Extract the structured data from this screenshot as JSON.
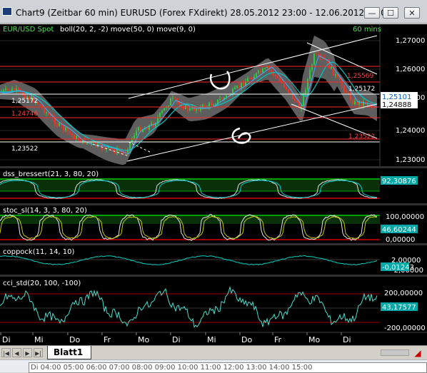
{
  "window": {
    "title": "Chart9 (Zeitbar 60 min)  EURUSD (Forex FXdirekt) 28.05.2012 23:00 - 12.06.2012 20:00",
    "minimize_glyph": "—",
    "maximize_glyph": "☐",
    "close_glyph": "✕"
  },
  "price_panel": {
    "symbol_label": "EUR/USD Spot",
    "indicators_label": "boll(20, 2, -2) move(50, 0) move(9, 0)",
    "timeframe_label": "60 mins",
    "axis_ticks": [
      "1,27000",
      "1,26000",
      "1,25000",
      "1,24000",
      "1,23000"
    ],
    "price_boxes": [
      {
        "text": "1,25101",
        "style": "box-white"
      },
      {
        "text": "1,24888",
        "style": "box-white"
      }
    ],
    "line_labels": {
      "right_red_top": "1,25569",
      "right_white": "1,25172",
      "right_red_bottom": "1,23522",
      "left_white": "1,25172",
      "left_red": "1,24746",
      "left_low": "1,23522"
    }
  },
  "panels": [
    {
      "name": "dss",
      "label": "dss_bressert(21, 3, 80, 20)",
      "value_box": "92,30876",
      "ticks": []
    },
    {
      "name": "stoc",
      "label": "stoc_sl(14, 3, 3, 80, 20)",
      "value_box": "46,60244",
      "ticks": [
        "100,00000",
        "0,00000"
      ]
    },
    {
      "name": "coppock",
      "label": "coppock(11, 14, 10)",
      "value_box": "-0,01243",
      "ticks": [
        "2,00000",
        "-2,00000"
      ]
    },
    {
      "name": "cci",
      "label": "cci_std(20, 100, -100)",
      "value_box": "43,17577",
      "ticks": [
        "200,00000",
        "-200,00000"
      ]
    }
  ],
  "time_axis": [
    "Di",
    "Mi",
    "Do",
    "Fr",
    "Mo",
    "Di",
    "Mi",
    "Do",
    "Fr",
    "Mo",
    "Di"
  ],
  "tabs": {
    "sheet": "Blatt1"
  },
  "taskbar_text": "Di  04:00  05:00  06:00  07:00  08:00  09:00  10:00  11:00  12:00  13:00  14:00  15:00",
  "colors": {
    "bg": "#000000",
    "grid": "#2a2a2a",
    "band_fill": "#6e6e6e",
    "ma_fast": "#00c8c8",
    "ma_slow": "#3fb0ff",
    "bull": "#2ecc40",
    "bear": "#ff3020",
    "red_line": "#ff2a2a",
    "green_zone": "#00a000",
    "red_zone": "#a00000",
    "osc": "#e0e0e0",
    "sig": "#c8c800",
    "cci": "#40e0d0"
  }
}
